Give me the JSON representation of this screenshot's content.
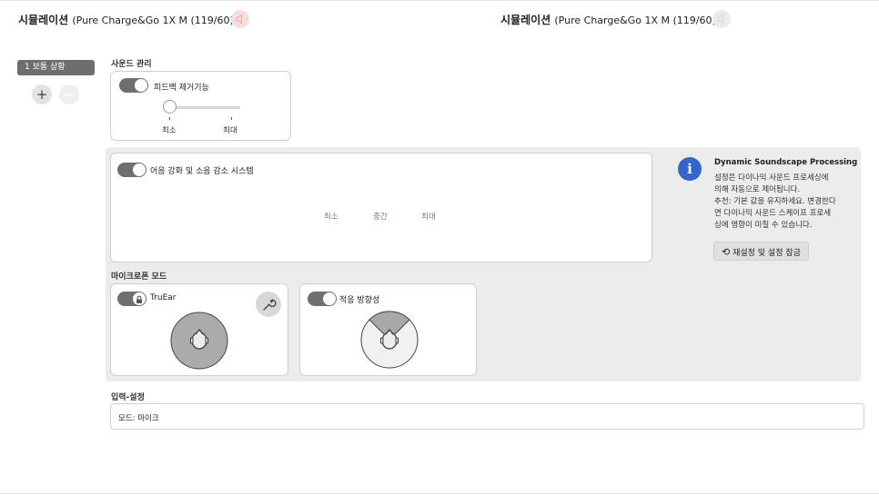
{
  "header": {
    "left": {
      "title": "시뮬레이션",
      "model": "(Pure Charge&Go 1X M (119/60))"
    },
    "right": {
      "title": "시뮬레이션",
      "model": "(Pure Charge&Go 1X M (119/60))"
    }
  },
  "programs": {
    "selected": "1  보통 상황",
    "add_label": "+",
    "remove_label": "−"
  },
  "sound_mgmt": {
    "label": "사운드 관리",
    "feedback": {
      "label": "피드백 제거기능",
      "enabled": true,
      "min": "최소",
      "max": "최대",
      "level": 0
    }
  },
  "speech": {
    "label": "어음 강화 및 소음 감소 시스템",
    "enabled": true,
    "levels": [
      "최소",
      "중간",
      "최대"
    ]
  },
  "info": {
    "title": "Dynamic Soundscape Processing",
    "lines": [
      "설정은 다이나믹 사운드 프로세싱에",
      "의해 자동으로 제어됩니다.",
      "추천: 기본 값을 유지하세요. 변경한다",
      "면 다이나믹 사운드 스케이프 프로세",
      "싱에 영향이 미칠 수 있습니다."
    ],
    "button": "재설정 및 설정 잠금"
  },
  "mic": {
    "label": "마이크로폰 모드",
    "trueear": {
      "label": "TruEar",
      "enabled": true,
      "locked": true
    },
    "adaptive": {
      "label": "적응 방향성",
      "enabled": true
    }
  },
  "input": {
    "label": "입력-설정",
    "mode": "모드: 마이크"
  },
  "colors": {
    "accent": "#3366cc",
    "toggle_on": "#6f6f6f",
    "panel": "#ececec"
  }
}
